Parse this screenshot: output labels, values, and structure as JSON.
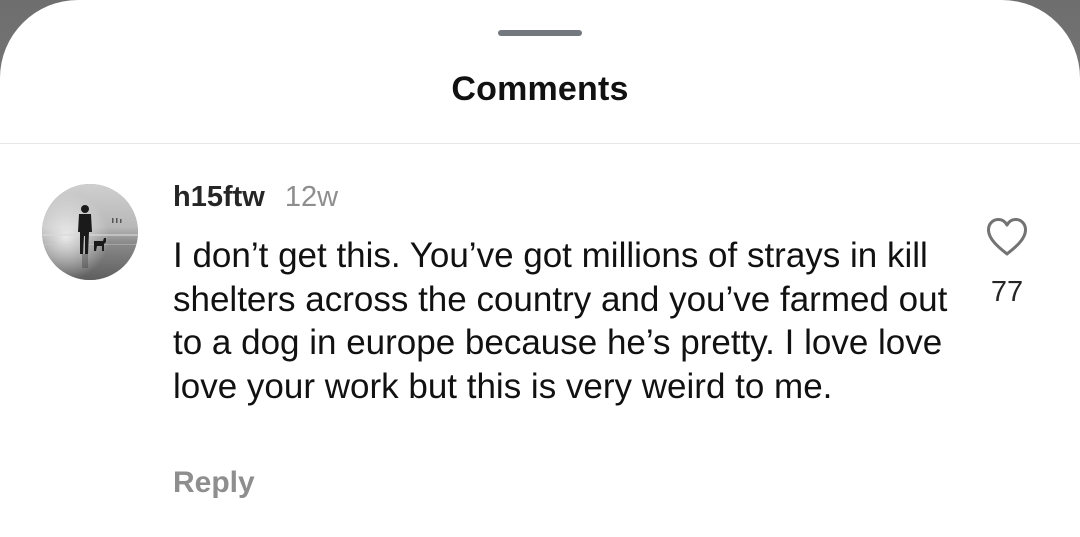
{
  "sheet": {
    "title": "Comments"
  },
  "comment": {
    "username": "h15ftw",
    "timestamp": "12w",
    "text": "I don’t get this. You’ve got millions of strays in kill shelters across the country and you’ve farmed out to a dog in europe because he’s pretty. I love love love your work but this is very weird to me.",
    "reply_label": "Reply",
    "like_count": "77",
    "like_icon": "heart-outline-icon",
    "avatar": "person-walking-dog-on-beach-photo"
  },
  "colors": {
    "background": "#ffffff",
    "primary_text": "#111111",
    "secondary_text": "#8e8e8e",
    "handle": "#73777e",
    "divider": "#e6e6e6"
  }
}
